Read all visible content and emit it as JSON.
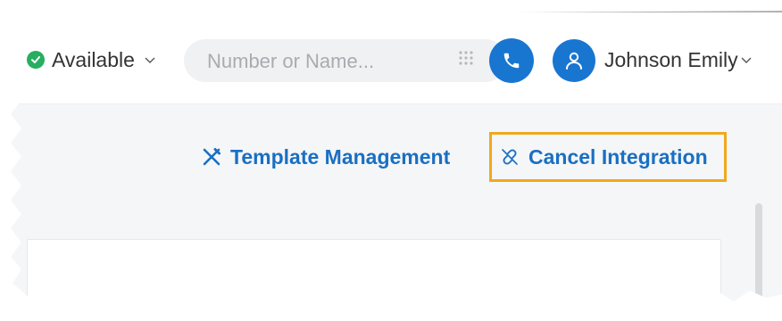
{
  "header": {
    "status": {
      "label": "Available",
      "color": "#27ae60",
      "icon": "check-circle-icon"
    },
    "search": {
      "placeholder": "Number or Name...",
      "value": ""
    },
    "call_button_icon": "phone-icon",
    "dialpad_icon": "dialpad-icon",
    "user": {
      "name": "Johnson Emily",
      "avatar_icon": "user-icon"
    }
  },
  "toolbar": {
    "template_management_label": "Template Management",
    "template_management_icon": "tools-icon",
    "cancel_integration_label": "Cancel Integration",
    "cancel_integration_icon": "unlink-icon",
    "highlight_color": "#f0a81c"
  },
  "colors": {
    "accent": "#1876d1",
    "link": "#1a6fc2",
    "background": "#f4f6f8"
  }
}
